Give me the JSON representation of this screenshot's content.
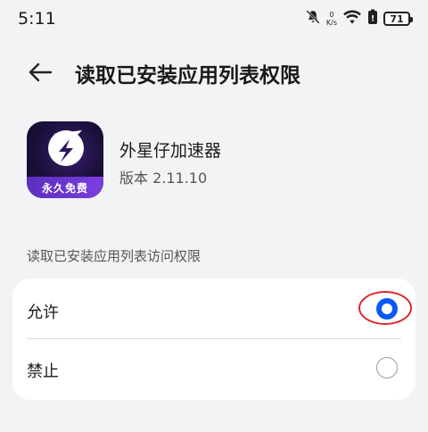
{
  "status_bar": {
    "time": "5:11",
    "net_speed_value": "0",
    "net_speed_unit": "K/s",
    "battery_level": "71",
    "icons": [
      "mute-icon",
      "wifi-icon",
      "battery-saver-icon",
      "battery-icon"
    ]
  },
  "header": {
    "title": "读取已安装应用列表权限"
  },
  "app": {
    "name": "外星仔加速器",
    "version": "版本 2.11.10",
    "icon_badge": "永久免费"
  },
  "permission": {
    "section_label": "读取已安装应用列表访问权限",
    "options": [
      {
        "label": "允许",
        "selected": true
      },
      {
        "label": "禁止",
        "selected": false
      }
    ]
  },
  "colors": {
    "background": "#f1f3f5",
    "card": "#ffffff",
    "accent": "#0a59f7",
    "annotation": "#e0262b"
  }
}
